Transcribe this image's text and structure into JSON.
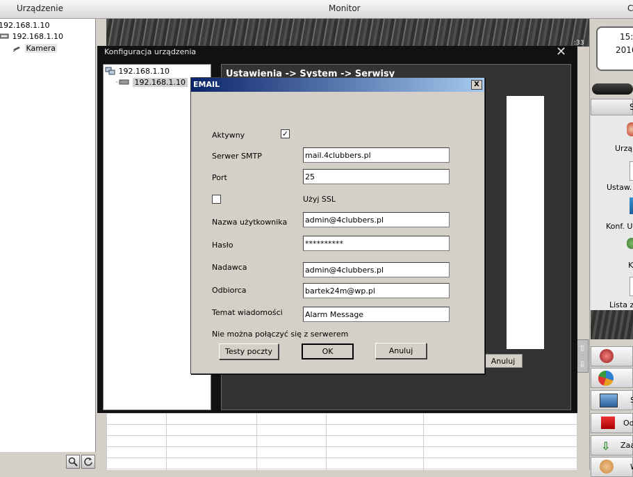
{
  "topbar": {
    "device_tab": "Urządzenie",
    "monitor_tab": "Monitor",
    "right_tab": "C"
  },
  "left_tree": {
    "items": [
      "192.168.1.10",
      "192.168.1.10",
      "Kamera"
    ]
  },
  "camera": {
    "time_fragment": ":33"
  },
  "config_dialog": {
    "title": "Konfiguracja urządzenia",
    "tree": [
      "192.168.1.10",
      "192.168.1.10"
    ],
    "breadcrumb": "Ustawienia -> System -> Serwisy",
    "cancel_label": "Anuluj"
  },
  "right_panel": {
    "clock_time": "15:",
    "clock_date": "2016",
    "header_fragment": "S",
    "items": [
      "Urzą",
      "Ustaw.",
      "Konf. U",
      "K",
      "Lista z"
    ],
    "buttons": [
      "",
      "",
      "S",
      "Odt",
      "Zaa",
      "W"
    ]
  },
  "email_dialog": {
    "title": "EMAIL",
    "close_label": "X",
    "active_label": "Aktywny",
    "active_checked": true,
    "smtp_label": "Serwer SMTP",
    "smtp_value": "mail.4clubbers.pl",
    "port_label": "Port",
    "port_value": "25",
    "ssl_label": "Użyj SSL",
    "ssl_checked": false,
    "username_label": "Nazwa użytkownika",
    "username_value": "admin@4clubbers.pl",
    "password_label": "Hasło",
    "password_value": "**********",
    "sender_label": "Nadawca",
    "sender_value": "admin@4clubbers.pl",
    "recipient_label": "Odbiorca",
    "recipient_value": "bartek24m@wp.pl",
    "subject_label": "Temat wiadomości",
    "subject_value": "Alarm Message",
    "status_text": "Nie można połączyć się z serwerem",
    "test_button": "Testy poczty",
    "ok_button": "OK",
    "cancel_button": "Anuluj"
  }
}
